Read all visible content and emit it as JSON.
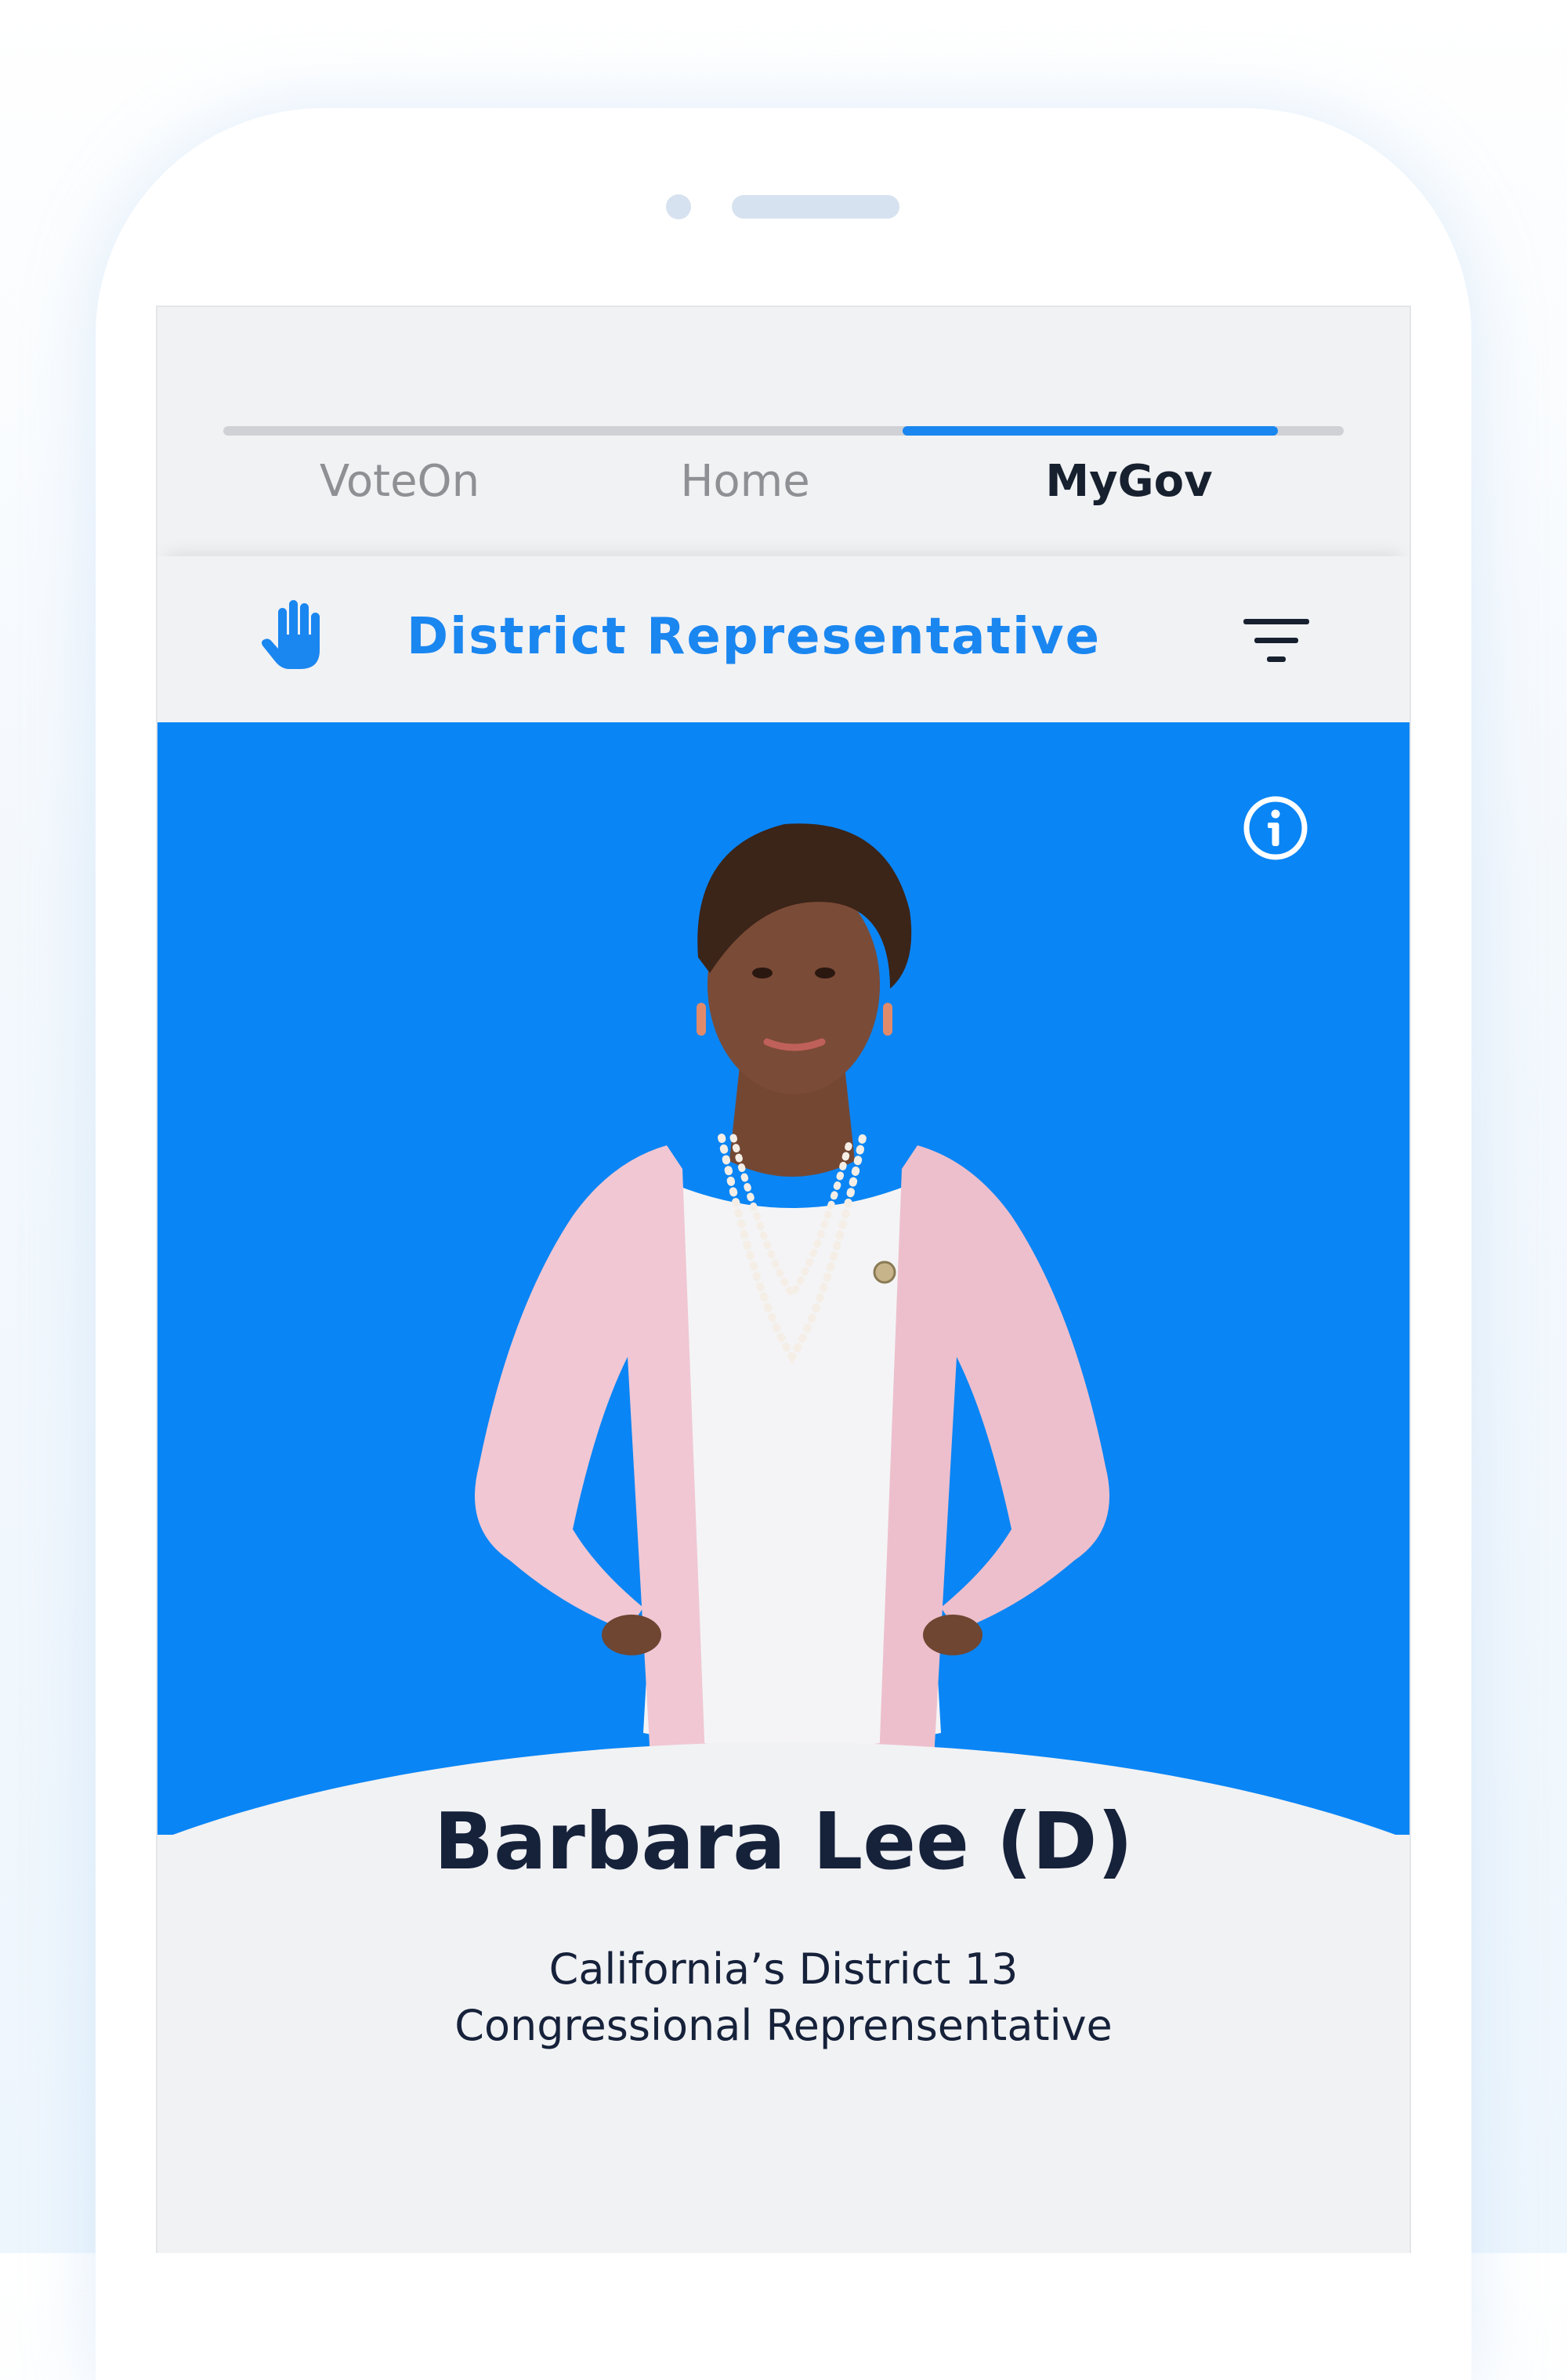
{
  "tabs": [
    {
      "label": "VoteOn",
      "active": false
    },
    {
      "label": "Home",
      "active": false
    },
    {
      "label": "MyGov",
      "active": true
    }
  ],
  "section": {
    "title": "District Representative",
    "icon": "raised-hand-icon",
    "filter_icon": "filter-icon"
  },
  "hero": {
    "info_icon": "info-icon",
    "background_color": "#0a85f5"
  },
  "representative": {
    "name": "Barbara Lee (D)",
    "district": "California’s District 13",
    "role": "Congressional Reprensentative"
  },
  "colors": {
    "accent": "#1a86f0",
    "text_dark": "#16213a",
    "tab_inactive": "#8e9094",
    "screen_bg": "#f1f2f4"
  }
}
